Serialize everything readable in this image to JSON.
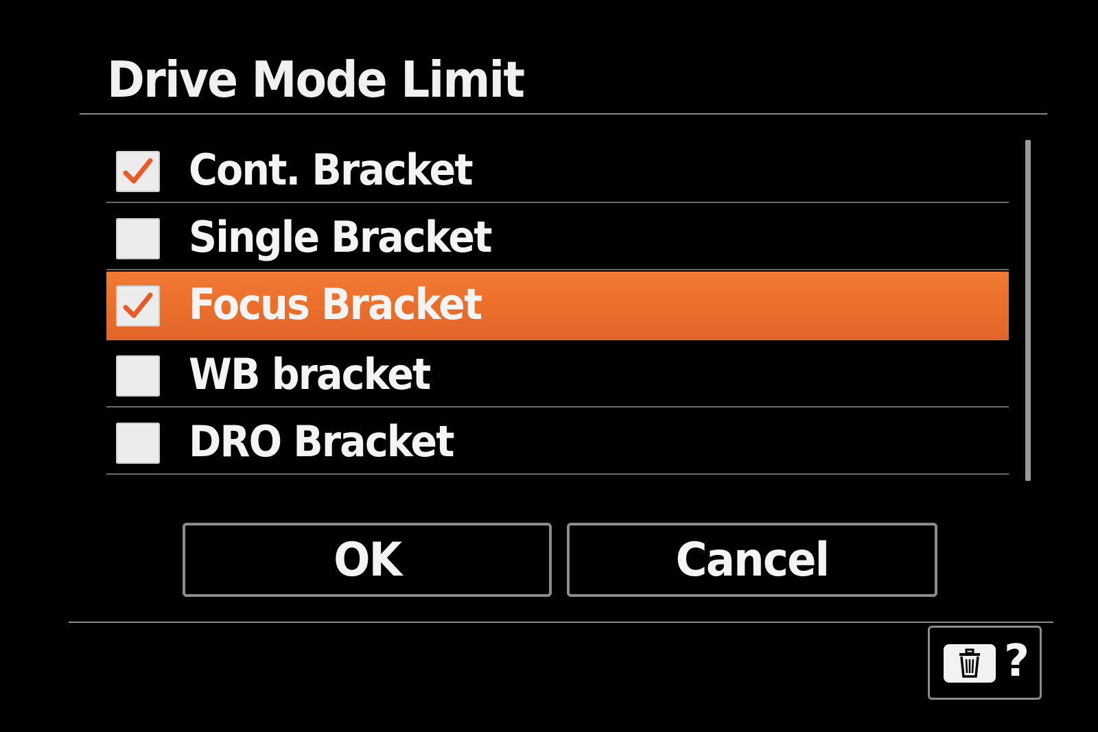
{
  "dialog": {
    "title": "Drive Mode Limit"
  },
  "options": [
    {
      "label": "Cont. Bracket",
      "checked": true,
      "selected": false
    },
    {
      "label": "Single Bracket",
      "checked": false,
      "selected": false
    },
    {
      "label": "Focus Bracket",
      "checked": true,
      "selected": true
    },
    {
      "label": "WB bracket",
      "checked": false,
      "selected": false
    },
    {
      "label": "DRO Bracket",
      "checked": false,
      "selected": false
    }
  ],
  "buttons": {
    "ok_label": "OK",
    "cancel_label": "Cancel"
  },
  "help": {
    "key_icon": "trash-icon",
    "symbol": "?"
  },
  "colors": {
    "background": "#000000",
    "highlight": "#eb6f2a",
    "check": "#eb5a24"
  }
}
